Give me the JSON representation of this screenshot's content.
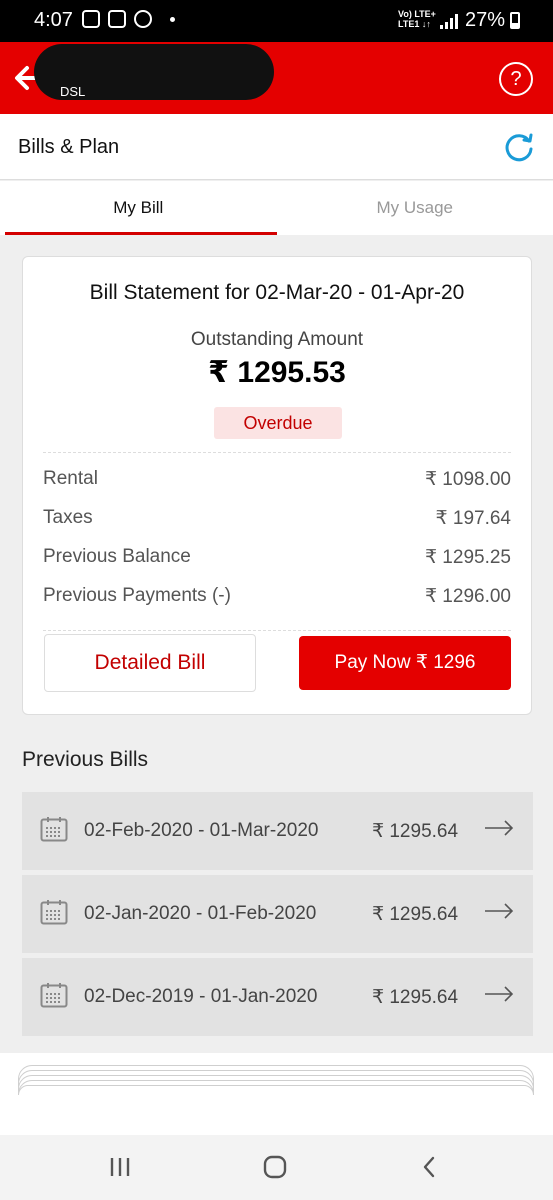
{
  "status_bar": {
    "time": "4:07",
    "network_top": "Vo) LTE+",
    "network_bottom": "LTE1 ↓↑",
    "battery": "27%"
  },
  "header": {
    "subtitle": "DSL",
    "help_glyph": "?",
    "icons": [
      "back-arrow-icon",
      "help-icon"
    ]
  },
  "subheader": {
    "title": "Bills & Plan",
    "refresh_icon": "refresh-icon"
  },
  "tabs": [
    {
      "label": "My Bill",
      "active": true
    },
    {
      "label": "My Usage",
      "active": false
    }
  ],
  "bill": {
    "statement_title": "Bill Statement for 02-Mar-20 - 01-Apr-20",
    "outstanding_label": "Outstanding Amount",
    "outstanding_amount": "₹ 1295.53",
    "status_badge": "Overdue",
    "rows": [
      {
        "label": "Rental",
        "value": "₹ 1098.00"
      },
      {
        "label": "Taxes",
        "value": "₹ 197.64"
      },
      {
        "label": "Previous Balance",
        "value": "₹ 1295.25"
      },
      {
        "label": "Previous Payments (-)",
        "value": "₹ 1296.00"
      }
    ],
    "detailed_bill_label": "Detailed Bill",
    "pay_now_label": "Pay Now ₹ 1296"
  },
  "previous_bills": {
    "title": "Previous Bills",
    "items": [
      {
        "dates": "02-Feb-2020 - 01-Mar-2020",
        "amount": "₹ 1295.64"
      },
      {
        "dates": "02-Jan-2020 - 01-Feb-2020",
        "amount": "₹ 1295.64"
      },
      {
        "dates": "02-Dec-2019 - 01-Jan-2020",
        "amount": "₹ 1295.64"
      }
    ]
  },
  "colors": {
    "brand_red": "#e40000",
    "overdue_bg": "#fbe3e3",
    "refresh_blue": "#1a9bd7"
  }
}
